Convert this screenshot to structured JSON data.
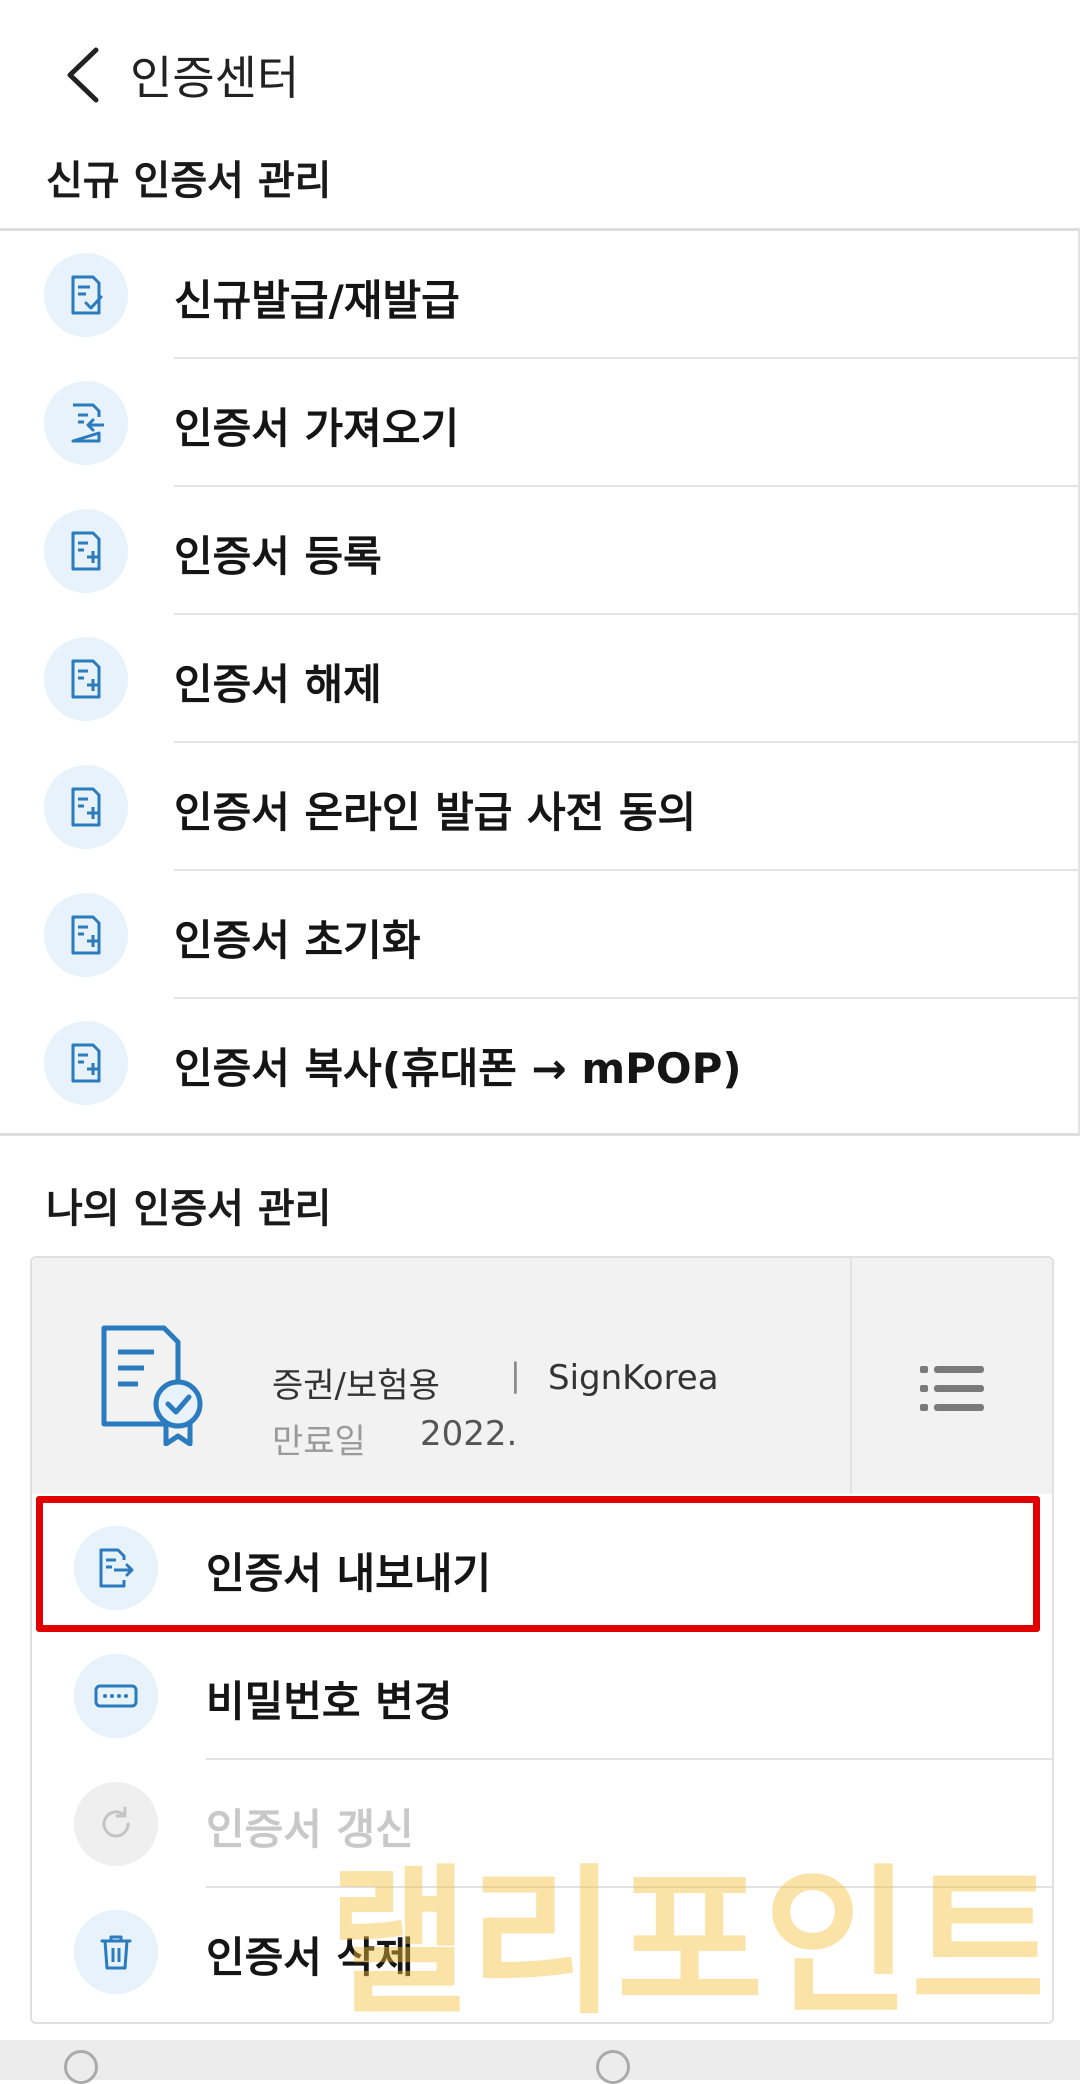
{
  "header": {
    "title": "인증센터"
  },
  "sections": {
    "new_cert_title": "신규 인증서 관리",
    "my_cert_title": "나의 인증서 관리"
  },
  "new_menu": [
    {
      "label": "신규발급/재발급",
      "icon": "document-check-icon"
    },
    {
      "label": "인증서 가져오기",
      "icon": "document-import-icon"
    },
    {
      "label": "인증서 등록",
      "icon": "document-add-icon"
    },
    {
      "label": "인증서 해제",
      "icon": "document-add-icon"
    },
    {
      "label": "인증서 온라인 발급 사전 동의",
      "icon": "document-add-icon"
    },
    {
      "label": "인증서 초기화",
      "icon": "document-add-icon"
    },
    {
      "label": "인증서 복사(휴대폰 → mPOP)",
      "icon": "document-add-icon"
    }
  ],
  "certificate": {
    "type": "증권/보험용",
    "separator": "|",
    "issuer": "SignKorea",
    "expiry_label": "만료일",
    "expiry_value": "2022."
  },
  "cert_actions": [
    {
      "label": "인증서 내보내기",
      "icon": "document-export-icon",
      "enabled": true
    },
    {
      "label": "비밀번호 변경",
      "icon": "password-keyboard-icon",
      "enabled": true
    },
    {
      "label": "인증서 갱신",
      "icon": "refresh-icon",
      "enabled": false
    },
    {
      "label": "인증서 삭제",
      "icon": "trash-icon",
      "enabled": true
    }
  ],
  "watermark": "랠리포인트",
  "colors": {
    "accent": "#2b7bbf",
    "icon_bg": "#e7f2fb",
    "highlight": "#e00000",
    "watermark": "#f6c23e"
  }
}
